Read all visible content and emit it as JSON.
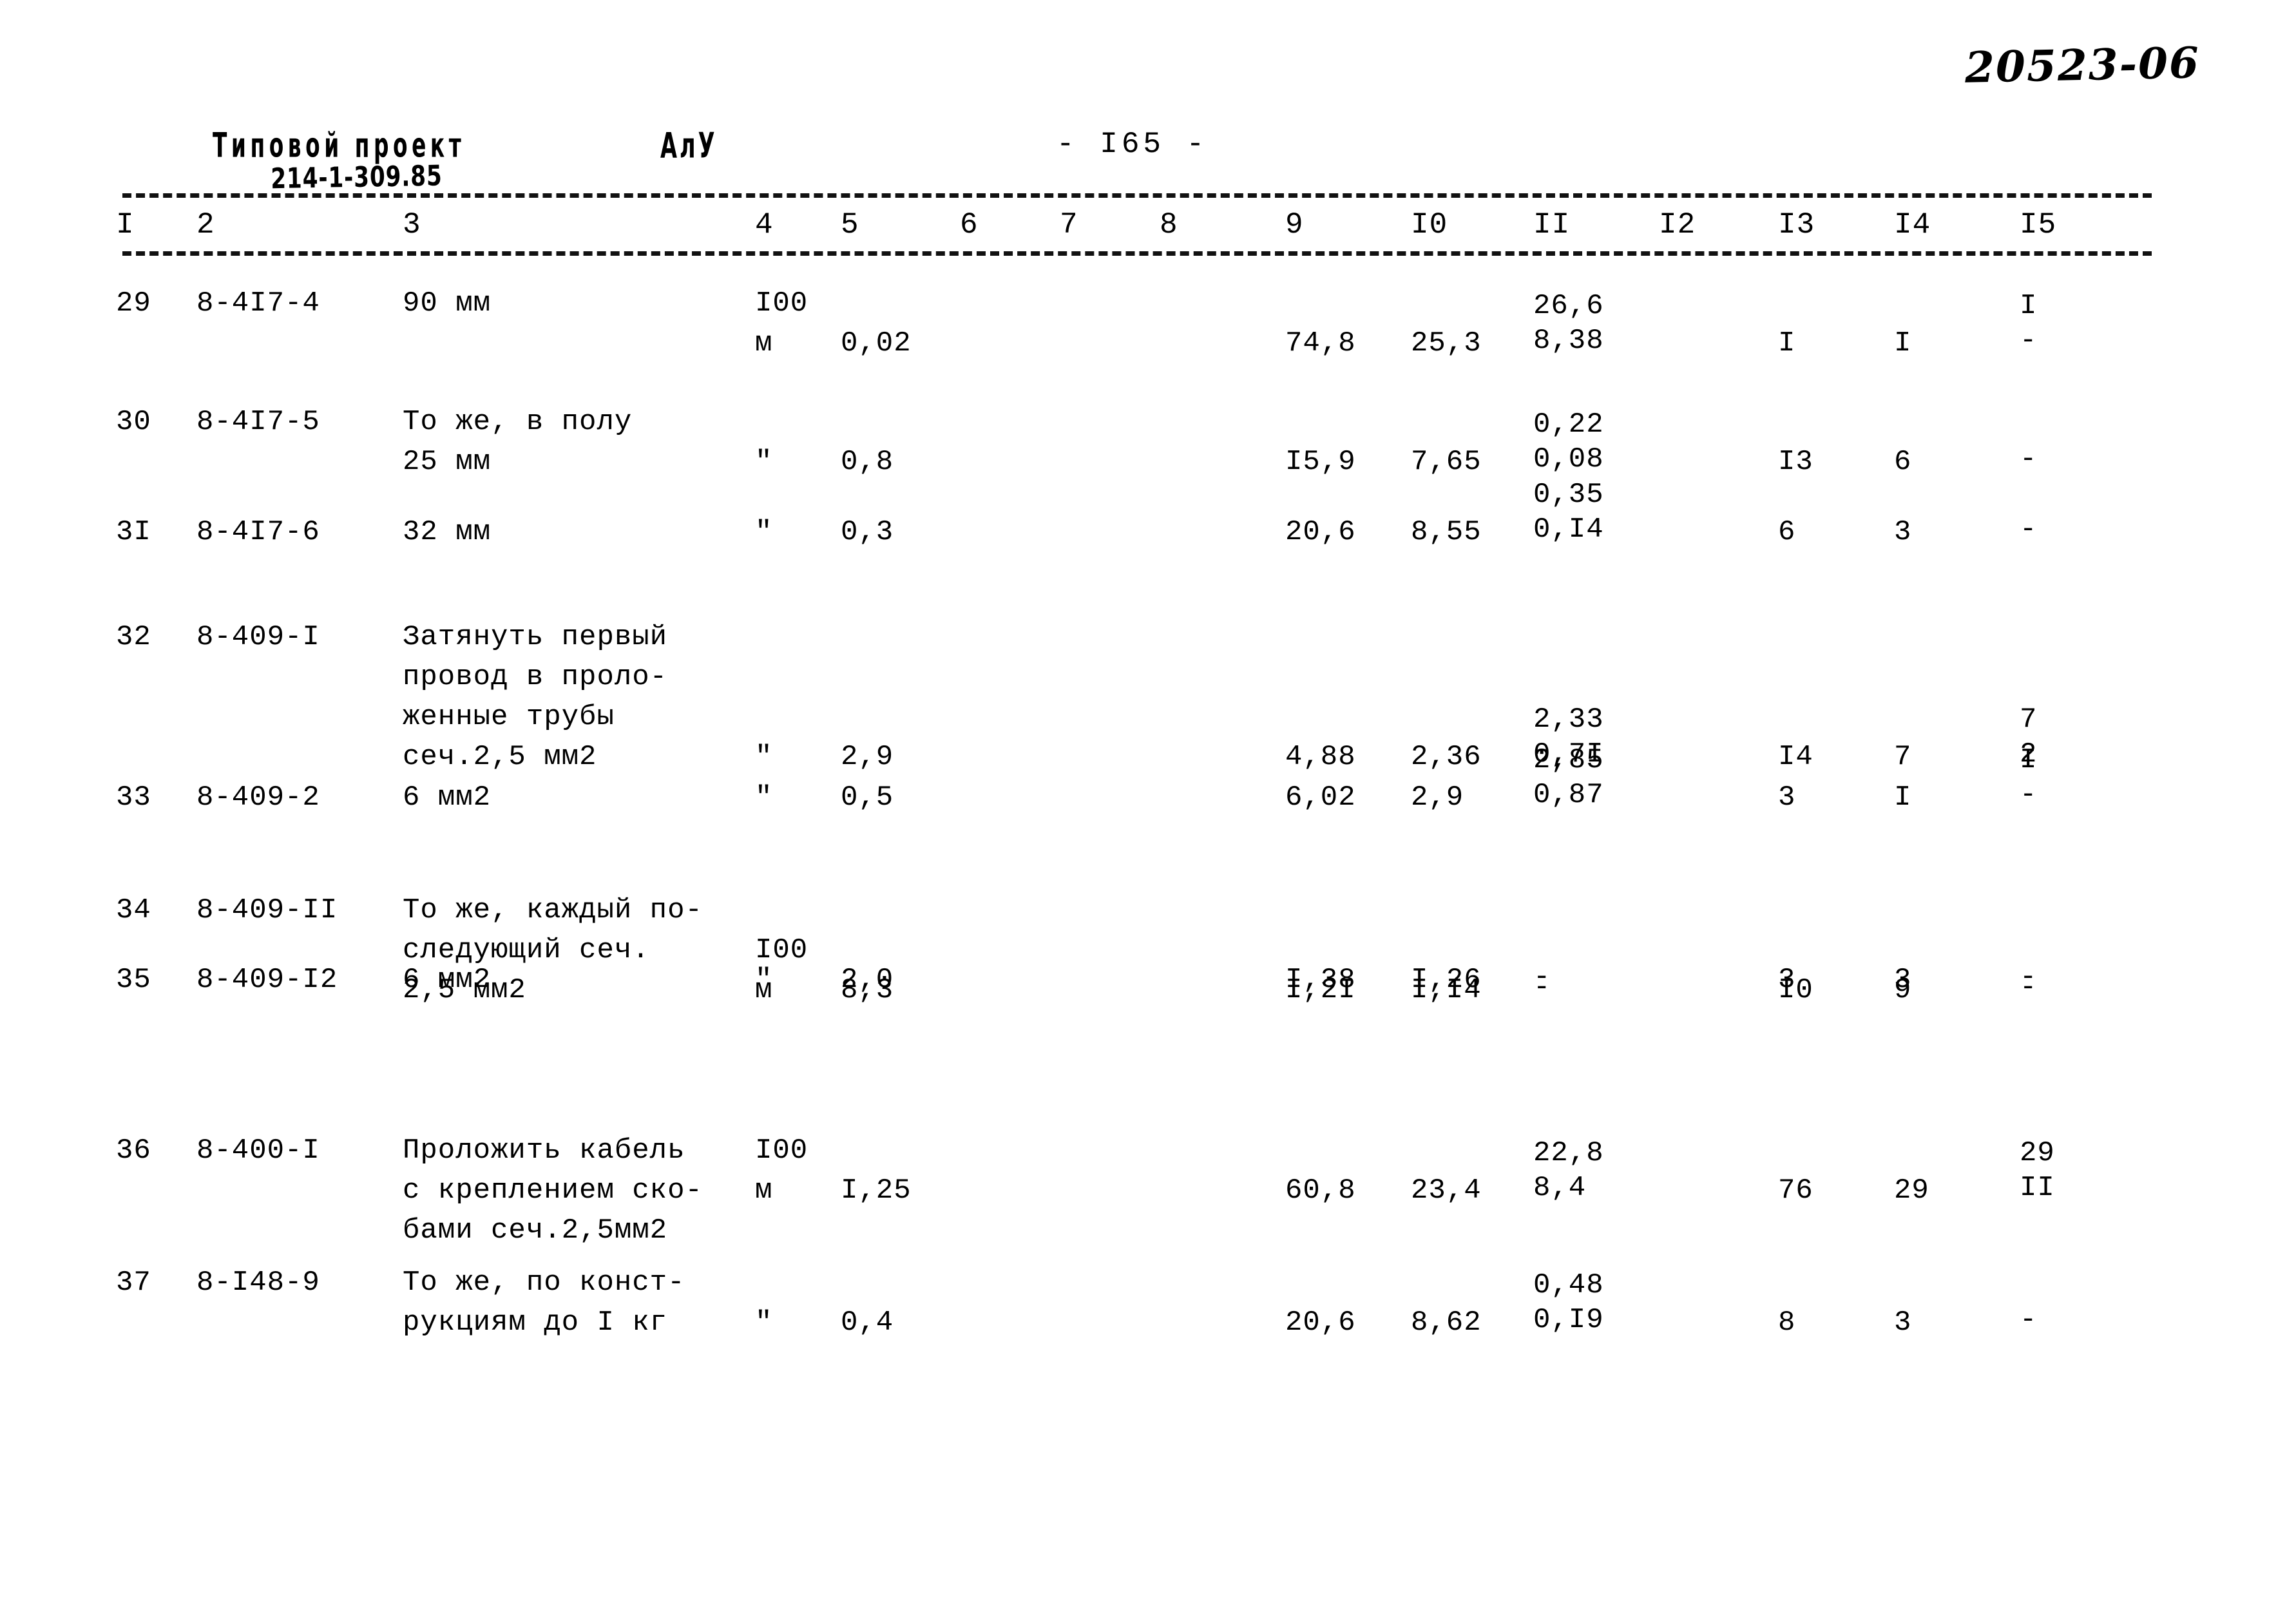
{
  "archive": {
    "number": "20523-06"
  },
  "stamp": {
    "title": "Типовой проект",
    "code": "214-1-309.85",
    "series": "АлУ"
  },
  "page": {
    "label": "- I65 -"
  },
  "table": {
    "column_headers": [
      "I",
      "2",
      "3",
      "4",
      "5",
      "6",
      "7",
      "8",
      "9",
      "I0",
      "II",
      "I2",
      "I3",
      "I4",
      "I5"
    ],
    "rows": [
      {
        "c1": "29",
        "c2": "8-4I7-4",
        "desc": [
          "90 мм"
        ],
        "c4": [
          "I00",
          "м"
        ],
        "c5": "0,02",
        "c6": "",
        "c7": "",
        "c8": "",
        "c9": "74,8",
        "c10": "25,3",
        "c11": [
          "26,6",
          "8,38"
        ],
        "c12": "",
        "c13": "I",
        "c14": "I",
        "c15": [
          "I",
          "-"
        ]
      },
      {
        "c1": "30",
        "c2": "8-4I7-5",
        "desc": [
          "То же, в полу",
          "25 мм"
        ],
        "c4": [
          "\""
        ],
        "c5": "0,8",
        "c6": "",
        "c7": "",
        "c8": "",
        "c9": "I5,9",
        "c10": "7,65",
        "c11": [
          "0,22",
          "0,08"
        ],
        "c12": "",
        "c13": "I3",
        "c14": "6",
        "c15": [
          "-"
        ]
      },
      {
        "c1": "3I",
        "c2": "8-4I7-6",
        "desc": [
          "32 мм"
        ],
        "c4": [
          "\""
        ],
        "c5": "0,3",
        "c6": "",
        "c7": "",
        "c8": "",
        "c9": "20,6",
        "c10": "8,55",
        "c11": [
          "0,35",
          "0,I4"
        ],
        "c12": "",
        "c13": "6",
        "c14": "3",
        "c15": [
          "-"
        ]
      },
      {
        "c1": "32",
        "c2": "8-409-I",
        "desc": [
          "Затянуть первый",
          "провод в проло-",
          "женные трубы",
          "сеч.2,5 мм2"
        ],
        "c4": [
          "\""
        ],
        "c5": "2,9",
        "c6": "",
        "c7": "",
        "c8": "",
        "c9": "4,88",
        "c10": "2,36",
        "c11": [
          "2,33",
          "0,7I"
        ],
        "c12": "",
        "c13": "I4",
        "c14": "7",
        "c15": [
          "7",
          "2"
        ]
      },
      {
        "c1": "33",
        "c2": "8-409-2",
        "desc": [
          "6 мм2"
        ],
        "c4": [
          "\""
        ],
        "c5": "0,5",
        "c6": "",
        "c7": "",
        "c8": "",
        "c9": "6,02",
        "c10": "2,9",
        "c11": [
          "2,85",
          "0,87"
        ],
        "c12": "",
        "c13": "3",
        "c14": "I",
        "c15": [
          "I",
          "-"
        ]
      },
      {
        "c1": "34",
        "c2": "8-409-II",
        "desc": [
          "То же, каждый по-",
          "следующий сеч.",
          "2,5 мм2"
        ],
        "c4": [
          "I00",
          "м"
        ],
        "c5": "8,3",
        "c6": "",
        "c7": "",
        "c8": "",
        "c9": "I,2I",
        "c10": "I,I4",
        "c11": [
          "-"
        ],
        "c12": "",
        "c13": "I0",
        "c14": "9",
        "c15": [
          "-"
        ]
      },
      {
        "c1": "35",
        "c2": "8-409-I2",
        "desc": [
          "6 мм2"
        ],
        "c4": [
          "\""
        ],
        "c5": "2,0",
        "c6": "",
        "c7": "",
        "c8": "",
        "c9": "I,38",
        "c10": "I,26",
        "c11": [
          "-"
        ],
        "c12": "",
        "c13": "3",
        "c14": "3",
        "c15": [
          "-"
        ]
      },
      {
        "c1": "36",
        "c2": "8-400-I",
        "desc": [
          "Проложить кабель",
          "с креплением ско-",
          "бами сеч.2,5мм2"
        ],
        "c4": [
          "I00",
          "м"
        ],
        "c5": "I,25",
        "c6": "",
        "c7": "",
        "c8": "",
        "c9": "60,8",
        "c10": "23,4",
        "c11": [
          "22,8",
          "8,4"
        ],
        "c12": "",
        "c13": "76",
        "c14": "29",
        "c15": [
          "29",
          "II"
        ]
      },
      {
        "c1": "37",
        "c2": "8-I48-9",
        "desc": [
          "То же, по конст-",
          "рукциям до I кг"
        ],
        "c4": [
          "\""
        ],
        "c5": "0,4",
        "c6": "",
        "c7": "",
        "c8": "",
        "c9": "20,6",
        "c10": "8,62",
        "c11": [
          "0,48",
          "0,I9"
        ],
        "c12": "",
        "c13": "8",
        "c14": "3",
        "c15": [
          "-"
        ]
      }
    ]
  }
}
